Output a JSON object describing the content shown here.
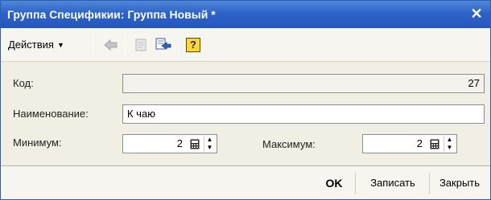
{
  "window": {
    "title": "Группа Спецификии: Группа Новый *",
    "close_icon": "close-icon"
  },
  "toolbar": {
    "actions_label": "Действия",
    "icons": [
      "arrow-left-icon",
      "document-icon",
      "refresh-icon",
      "help-icon"
    ],
    "help_glyph": "?"
  },
  "form": {
    "code_label": "Код:",
    "code_value": "27",
    "name_label": "Наименование:",
    "name_value": "К чаю",
    "min_label": "Минимум:",
    "min_value": "2",
    "max_label": "Максимум:",
    "max_value": "2"
  },
  "footer": {
    "ok_label": "OK",
    "save_label": "Записать",
    "close_label": "Закрыть"
  },
  "colors": {
    "titlebar": "#2d63c8",
    "panel": "#f1efe4"
  }
}
